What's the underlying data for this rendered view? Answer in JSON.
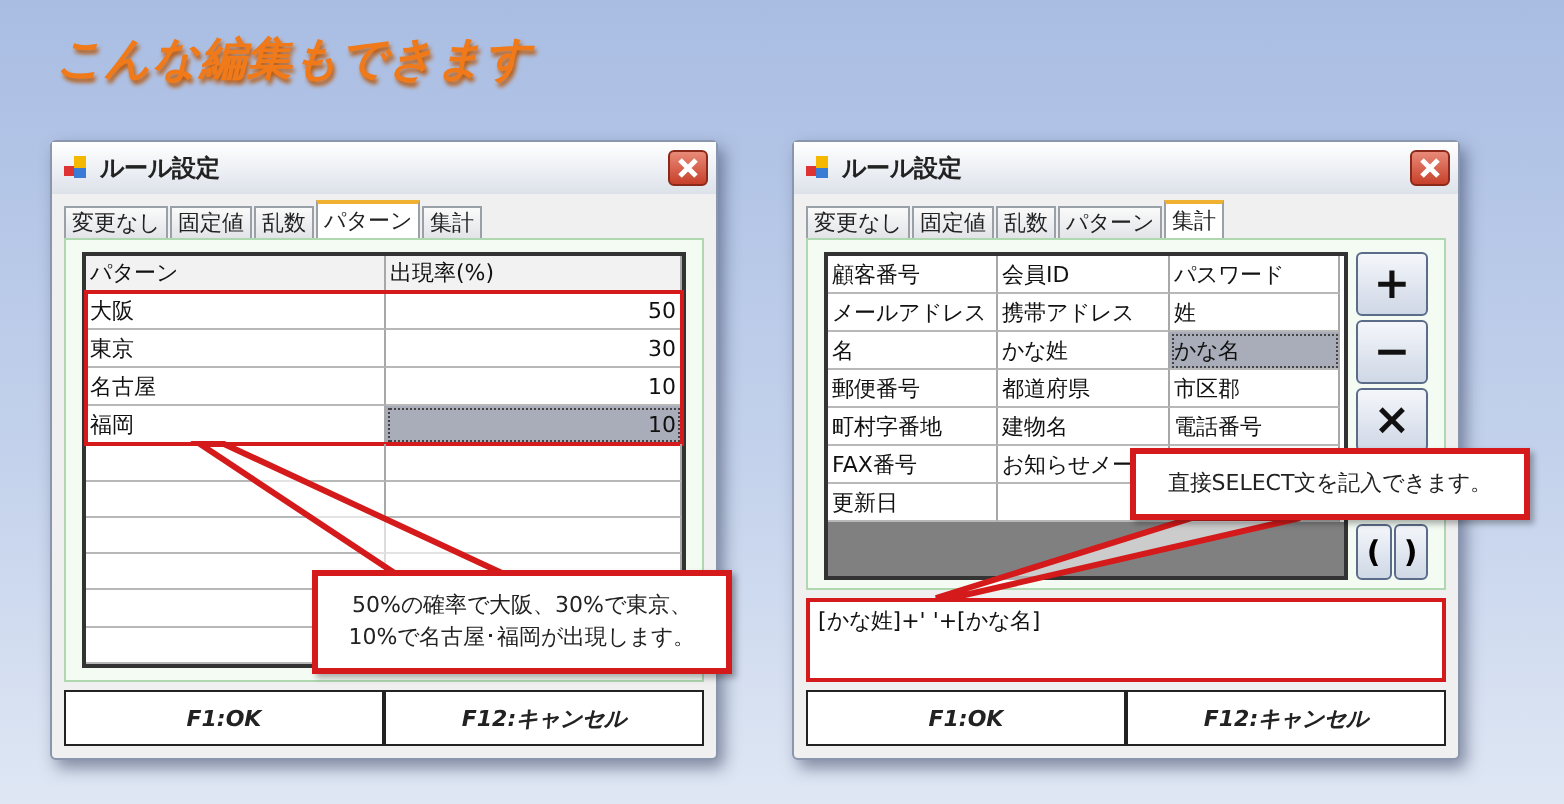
{
  "heading": "こんな編集もできます",
  "windows": [
    {
      "kind": "pattern",
      "title": "ルール設定",
      "tabs": [
        {
          "label": "変更なし",
          "selected": false
        },
        {
          "label": "固定値",
          "selected": false
        },
        {
          "label": "乱数",
          "selected": false
        },
        {
          "label": "パターン",
          "selected": true
        },
        {
          "label": "集計",
          "selected": false
        }
      ],
      "columns": [
        "パターン",
        "出現率(%)"
      ],
      "rows": [
        {
          "pattern": "大阪",
          "rate": "50",
          "selected": false
        },
        {
          "pattern": "東京",
          "rate": "30",
          "selected": false
        },
        {
          "pattern": "名古屋",
          "rate": "10",
          "selected": false
        },
        {
          "pattern": "福岡",
          "rate": "10",
          "selected": true
        }
      ],
      "callout": "50%の確率で大阪、30%で東京、10%で名古屋･福岡が出現します。",
      "buttons": [
        "F1:OK",
        "F12:キャンセル"
      ]
    },
    {
      "kind": "aggregate",
      "title": "ルール設定",
      "tabs": [
        {
          "label": "変更なし",
          "selected": false
        },
        {
          "label": "固定値",
          "selected": false
        },
        {
          "label": "乱数",
          "selected": false
        },
        {
          "label": "パターン",
          "selected": false
        },
        {
          "label": "集計",
          "selected": true
        }
      ],
      "cells": [
        [
          {
            "text": "顧客番号",
            "selected": false
          },
          {
            "text": "会員ID",
            "selected": false
          },
          {
            "text": "パスワード",
            "selected": false
          }
        ],
        [
          {
            "text": "メールアドレス",
            "selected": false
          },
          {
            "text": "携帯アドレス",
            "selected": false
          },
          {
            "text": "姓",
            "selected": false
          }
        ],
        [
          {
            "text": "名",
            "selected": false
          },
          {
            "text": "かな姓",
            "selected": false
          },
          {
            "text": "かな名",
            "selected": true
          }
        ],
        [
          {
            "text": "郵便番号",
            "selected": false
          },
          {
            "text": "都道府県",
            "selected": false
          },
          {
            "text": "市区郡",
            "selected": false
          }
        ],
        [
          {
            "text": "町村字番地",
            "selected": false
          },
          {
            "text": "建物名",
            "selected": false
          },
          {
            "text": "電話番号",
            "selected": false
          }
        ],
        [
          {
            "text": "FAX番号",
            "selected": false
          },
          {
            "text": "お知らせメー",
            "selected": false
          },
          {}
        ],
        [
          {
            "text": "更新日",
            "selected": false
          },
          {
            "selected": false
          },
          {}
        ]
      ],
      "tool_buttons": [
        "+",
        "−",
        "×"
      ],
      "paren_buttons": [
        "(",
        ")"
      ],
      "expression": "[かな姓]+' '+[かな名]",
      "callout": "直接SELECT文を記入できます。",
      "buttons": [
        "F1:OK",
        "F12:キャンセル"
      ]
    }
  ]
}
